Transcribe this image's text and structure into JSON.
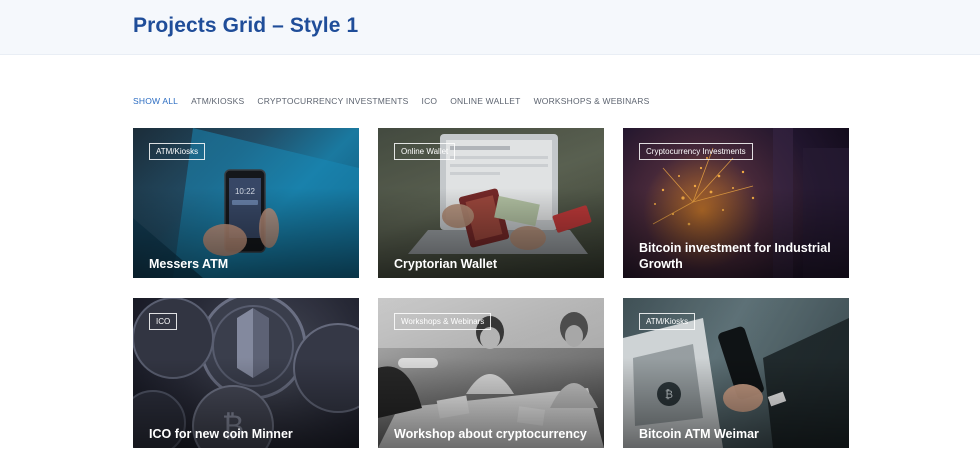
{
  "header": {
    "title": "Projects Grid – Style 1"
  },
  "filters": [
    {
      "label": "SHOW ALL",
      "active": true
    },
    {
      "label": "ATM/KIOSKS",
      "active": false
    },
    {
      "label": "CRYPTOCURRENCY INVESTMENTS",
      "active": false
    },
    {
      "label": "ICO",
      "active": false
    },
    {
      "label": "ONLINE WALLET",
      "active": false
    },
    {
      "label": "WORKSHOPS & WEBINARS",
      "active": false
    }
  ],
  "projects": [
    {
      "tag": "ATM/Kiosks",
      "title": "Messers ATM"
    },
    {
      "tag": "Online Wallet",
      "title": "Cryptorian Wallet"
    },
    {
      "tag": "Cryptocurrency Investments",
      "title": "Bitcoin investment for Industrial Growth"
    },
    {
      "tag": "ICO",
      "title": "ICO for new coin Minner"
    },
    {
      "tag": "Workshops & Webinars",
      "title": "Workshop about cryptocurrency"
    },
    {
      "tag": "ATM/Kiosks",
      "title": "Bitcoin ATM Weimar"
    }
  ],
  "colors": {
    "title": "#1f4d99",
    "active_filter": "#2b6cc2",
    "filter": "#5d6470",
    "header_bg": "#f5f8fc"
  }
}
